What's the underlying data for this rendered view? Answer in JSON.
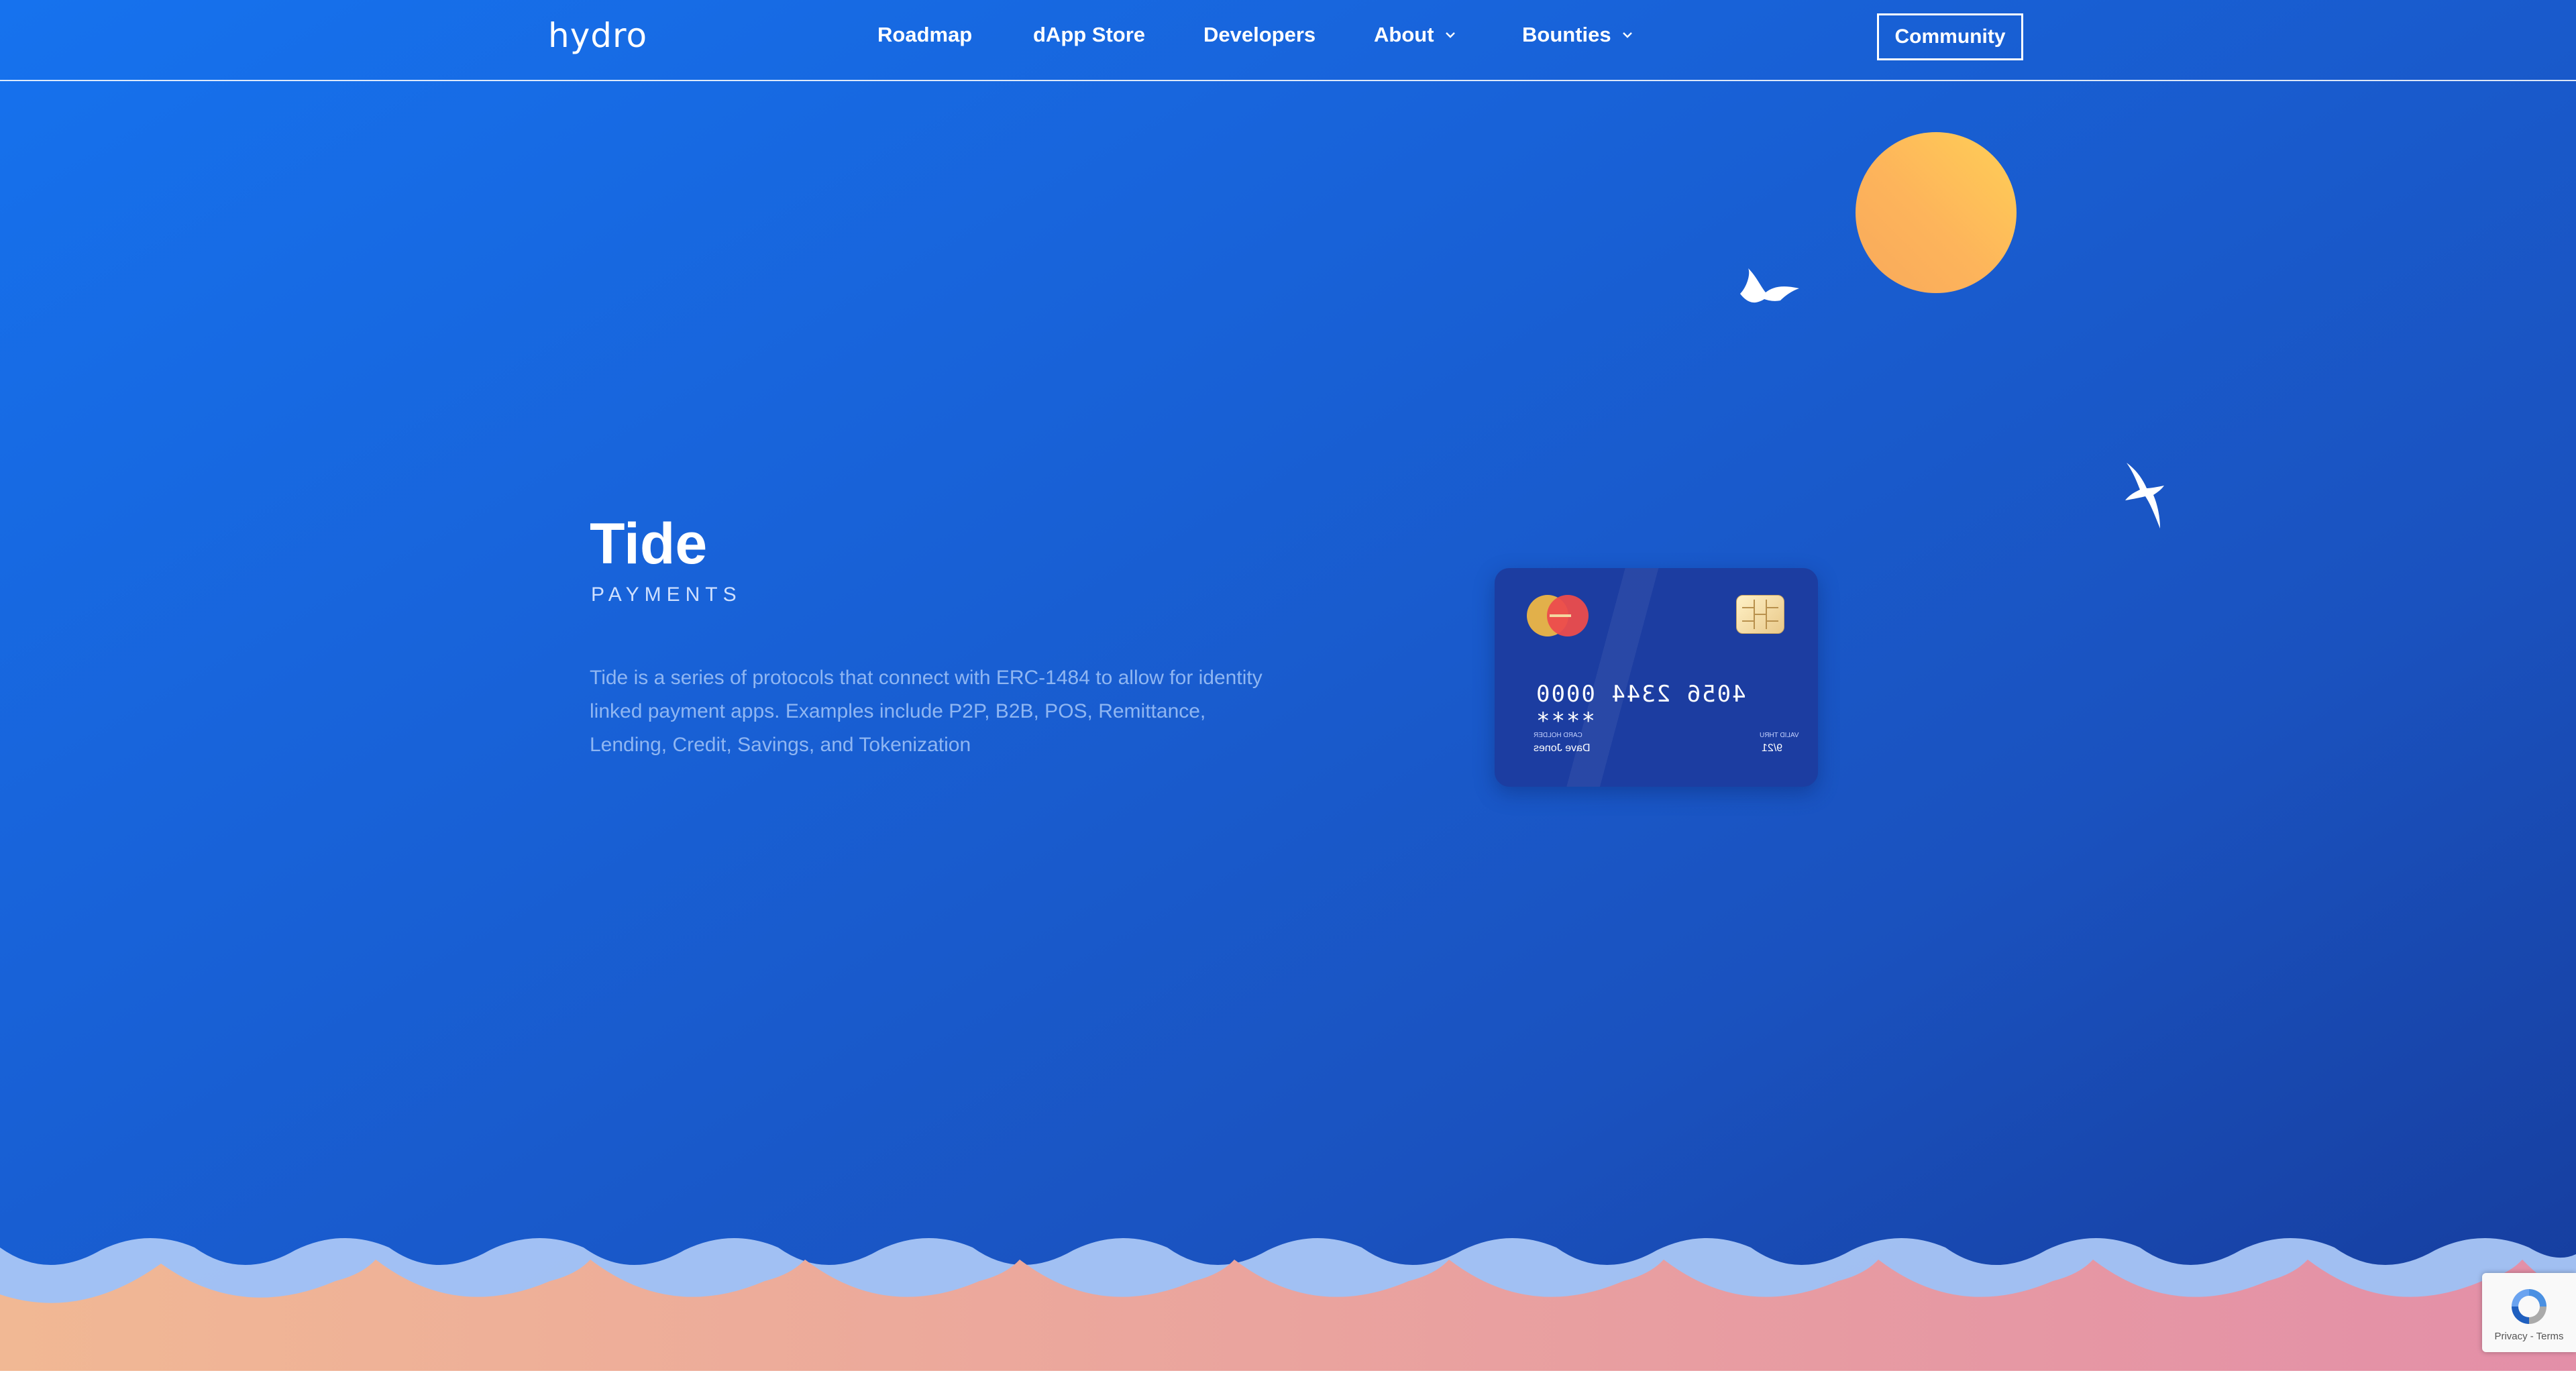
{
  "header": {
    "logo": "hydro",
    "nav": [
      {
        "label": "Roadmap"
      },
      {
        "label": "dApp Store"
      },
      {
        "label": "Developers"
      },
      {
        "label": "About"
      },
      {
        "label": "Bounties"
      }
    ],
    "community_label": "Community"
  },
  "hero": {
    "title": "Tide",
    "subtitle": "PAYMENTS",
    "description": "Tide is a series of protocols that connect with ERC-1484 to allow for identity linked payment apps. Examples include P2P, B2B, POS, Remittance, Lending, Credit, Savings, and Tokenization"
  },
  "card": {
    "number": "4056 2344 0000 ****",
    "holder_label": "CARD HOLDER",
    "holder_name": "Dave Jones",
    "valid_label": "VALID THRU",
    "valid_value": "9/21"
  },
  "recaptcha": {
    "links": "Privacy - Terms"
  },
  "colors": {
    "background_start": "#1672ee",
    "background_end": "#163c9c",
    "sun": "#fdb45b",
    "card": "#1c3da1",
    "wave_front_start": "#f1b894",
    "wave_front_end": "#e38fa8",
    "wave_back": "#a9c6f5"
  },
  "icons": {
    "about_caret": "chevron-down-icon",
    "bounties_caret": "chevron-down-icon",
    "sun": "sun-illustration",
    "birds": "bird-icon",
    "recaptcha": "recaptcha-icon"
  }
}
